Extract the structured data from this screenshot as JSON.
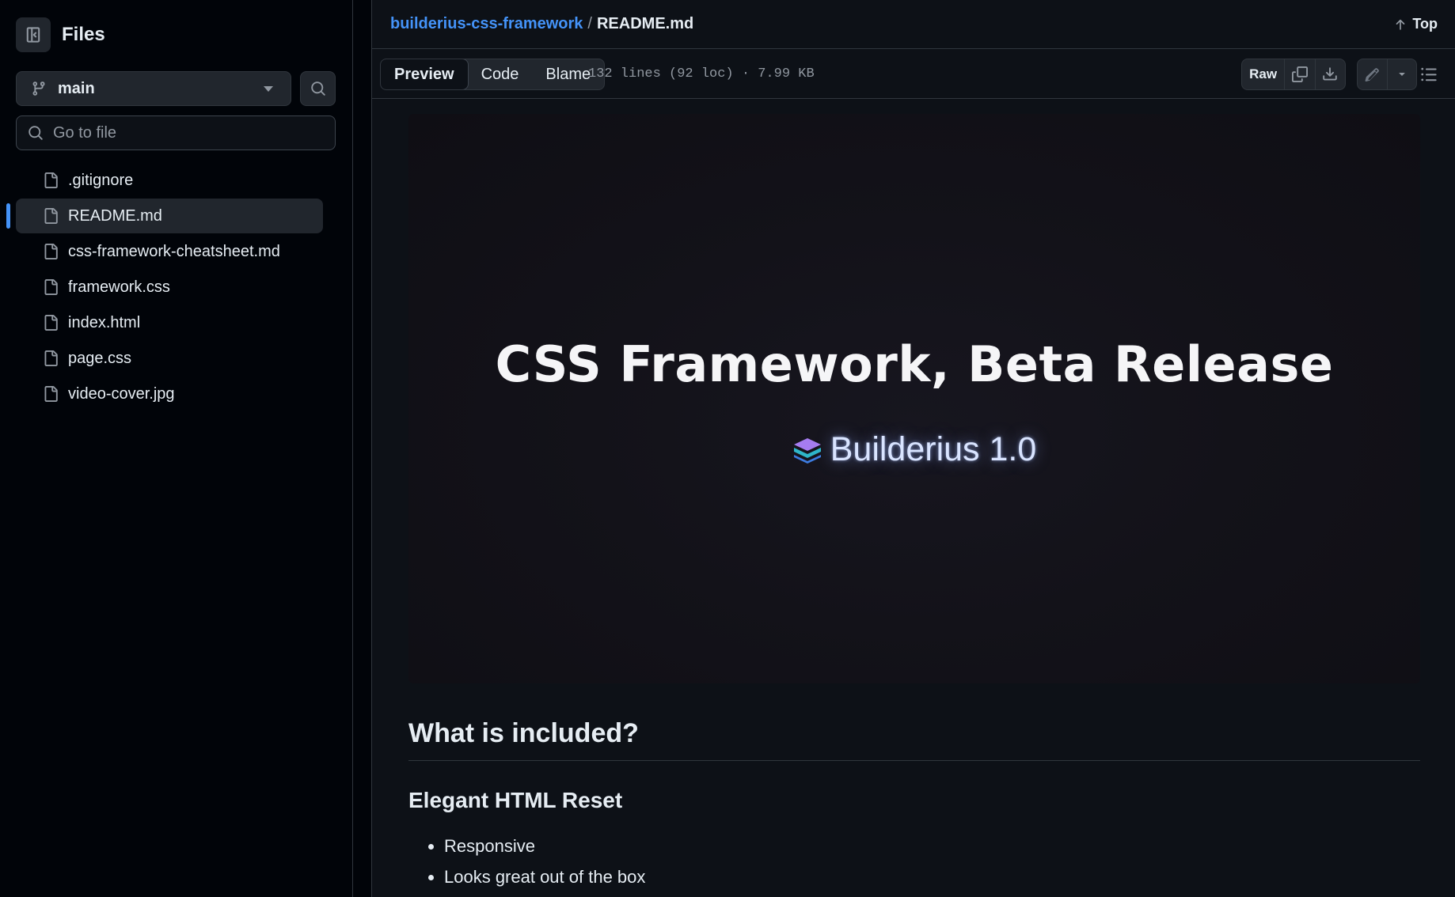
{
  "sidebar": {
    "title": "Files",
    "branch": "main",
    "search_placeholder": "Go to file",
    "files": [
      {
        "name": ".gitignore",
        "active": false
      },
      {
        "name": "README.md",
        "active": true
      },
      {
        "name": "css-framework-cheatsheet.md",
        "active": false
      },
      {
        "name": "framework.css",
        "active": false
      },
      {
        "name": "index.html",
        "active": false
      },
      {
        "name": "page.css",
        "active": false
      },
      {
        "name": "video-cover.jpg",
        "active": false
      }
    ]
  },
  "header": {
    "repo": "builderius-css-framework",
    "separator": "/",
    "file": "README.md",
    "top_label": "Top"
  },
  "toolbar": {
    "tabs": [
      "Preview",
      "Code",
      "Blame"
    ],
    "active_tab": "Preview",
    "file_info": "132 lines (92 loc) · 7.99 KB",
    "raw_label": "Raw"
  },
  "readme": {
    "hero_title": "CSS Framework, Beta Release",
    "hero_brand": "Builderius 1.0",
    "h2": "What is included?",
    "h3": "Elegant HTML Reset",
    "list": [
      "Responsive",
      "Looks great out of the box"
    ]
  },
  "colors": {
    "accent": "#4493f8",
    "bg": "#0d1117",
    "sidebar_bg": "#010409",
    "border": "#30363d"
  }
}
